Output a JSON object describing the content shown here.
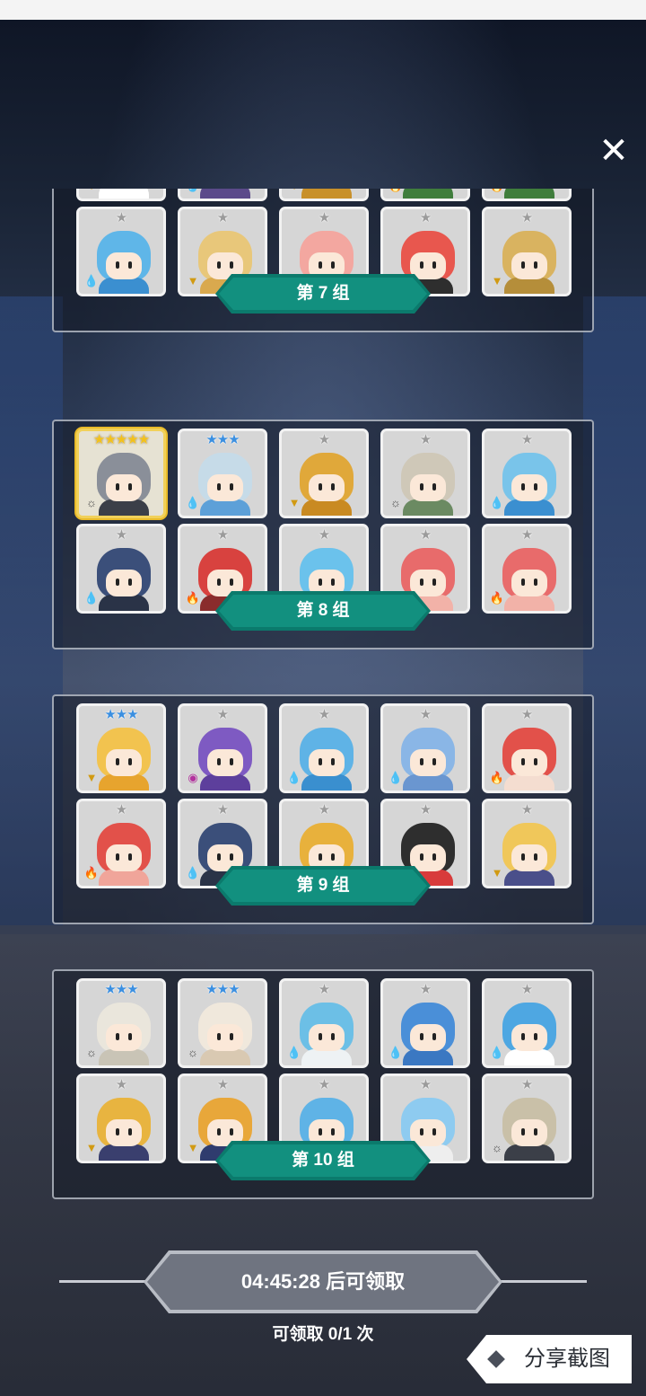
{
  "header": {
    "close_icon": "close-icon"
  },
  "groups": [
    {
      "label": "第 7 组",
      "rows": [
        [
          {
            "stars": "",
            "star_color": "gray",
            "element": "earth",
            "hair": "#f2cf6b",
            "outfit": "#ffffff"
          },
          {
            "stars": "",
            "star_color": "gray",
            "element": "water",
            "hair": "#7cc0e6",
            "outfit": "#5b4a8a"
          },
          {
            "stars": "",
            "star_color": "gray",
            "element": "earth",
            "hair": "#d6a43c",
            "outfit": "#c8902a"
          },
          {
            "stars": "",
            "star_color": "gray",
            "element": "fire",
            "hair": "#e8636a",
            "outfit": "#3f7d3c"
          },
          {
            "stars": "",
            "star_color": "gray",
            "element": "fire",
            "hair": "#e8636a",
            "outfit": "#3f7d3c"
          }
        ],
        [
          {
            "stars": "★",
            "star_color": "gray",
            "element": "water",
            "hair": "#5fb6e8",
            "outfit": "#3b8fd0"
          },
          {
            "stars": "★",
            "star_color": "gray",
            "element": "earth",
            "hair": "#e8c77a",
            "outfit": "#d9a94e"
          },
          {
            "stars": "★",
            "star_color": "gray",
            "element": "fire",
            "hair": "#f3a7a0",
            "outfit": "#e45b55"
          },
          {
            "stars": "★",
            "star_color": "gray",
            "element": "fire",
            "hair": "#e8574e",
            "outfit": "#2e2e2e"
          },
          {
            "stars": "★",
            "star_color": "gray",
            "element": "earth",
            "hair": "#d9b360",
            "outfit": "#b58e3a"
          }
        ]
      ]
    },
    {
      "label": "第 8 组",
      "rows": [
        [
          {
            "stars": "★★★★★",
            "star_color": "gold",
            "element": "light",
            "hair": "#8a8f99",
            "outfit": "#3b3f48",
            "highlight": true
          },
          {
            "stars": "★★★",
            "star_color": "blue",
            "element": "water",
            "hair": "#c6dbe8",
            "outfit": "#5da0d8"
          },
          {
            "stars": "★",
            "star_color": "gray",
            "element": "earth",
            "hair": "#e0a83a",
            "outfit": "#c98a22"
          },
          {
            "stars": "★",
            "star_color": "gray",
            "element": "light",
            "hair": "#cfc8b8",
            "outfit": "#6b8a62"
          },
          {
            "stars": "★",
            "star_color": "gray",
            "element": "water",
            "hair": "#79c4ea",
            "outfit": "#3b8fd0"
          }
        ],
        [
          {
            "stars": "★",
            "star_color": "gray",
            "element": "water",
            "hair": "#3b4f7a",
            "outfit": "#2a3347"
          },
          {
            "stars": "★",
            "star_color": "gray",
            "element": "fire",
            "hair": "#d8423f",
            "outfit": "#8a2c2c"
          },
          {
            "stars": "★",
            "star_color": "gray",
            "element": "water",
            "hair": "#6bc2ec",
            "outfit": "#eaeef2"
          },
          {
            "stars": "★",
            "star_color": "gray",
            "element": "fire",
            "hair": "#e86b6b",
            "outfit": "#f2b2a8"
          },
          {
            "stars": "★",
            "star_color": "gray",
            "element": "fire",
            "hair": "#e86b6b",
            "outfit": "#f2b2a8"
          }
        ]
      ]
    },
    {
      "label": "第 9 组",
      "rows": [
        [
          {
            "stars": "★★★",
            "star_color": "blue",
            "element": "earth",
            "hair": "#f2c34f",
            "outfit": "#e7a42e"
          },
          {
            "stars": "★",
            "star_color": "gray",
            "element": "dark",
            "hair": "#7e5ac2",
            "outfit": "#5d3f9c"
          },
          {
            "stars": "★",
            "star_color": "gray",
            "element": "water",
            "hair": "#5fb3e6",
            "outfit": "#3a8fcf"
          },
          {
            "stars": "★",
            "star_color": "gray",
            "element": "water",
            "hair": "#8ab6e6",
            "outfit": "#6a96d0"
          },
          {
            "stars": "★",
            "star_color": "gray",
            "element": "fire",
            "hair": "#e2514a",
            "outfit": "#f4ddd0"
          }
        ],
        [
          {
            "stars": "★",
            "star_color": "gray",
            "element": "fire",
            "hair": "#e2514a",
            "outfit": "#f0a59a"
          },
          {
            "stars": "★",
            "star_color": "gray",
            "element": "water",
            "hair": "#3b4f7a",
            "outfit": "#2a3347"
          },
          {
            "stars": "★",
            "star_color": "gray",
            "element": "earth",
            "hair": "#e8b13c",
            "outfit": "#2e2e2e"
          },
          {
            "stars": "★",
            "star_color": "gray",
            "element": "fire",
            "hair": "#2e2e2e",
            "outfit": "#d83b3b"
          },
          {
            "stars": "★",
            "star_color": "gray",
            "element": "earth",
            "hair": "#f0c75a",
            "outfit": "#4a4f8a"
          }
        ]
      ]
    },
    {
      "label": "第 10 组",
      "rows": [
        [
          {
            "stars": "★★★",
            "star_color": "blue",
            "element": "light",
            "hair": "#eae6dc",
            "outfit": "#c9c4b6"
          },
          {
            "stars": "★★★",
            "star_color": "blue",
            "element": "light",
            "hair": "#f0e8dc",
            "outfit": "#d9c9b2"
          },
          {
            "stars": "★",
            "star_color": "gray",
            "element": "water",
            "hair": "#6cbfe6",
            "outfit": "#eef2f4"
          },
          {
            "stars": "★",
            "star_color": "gray",
            "element": "water",
            "hair": "#4a8fd8",
            "outfit": "#3b78c2"
          },
          {
            "stars": "★",
            "star_color": "gray",
            "element": "water",
            "hair": "#4ea7e2",
            "outfit": "#ffffff"
          }
        ],
        [
          {
            "stars": "★",
            "star_color": "gray",
            "element": "earth",
            "hair": "#e8b440",
            "outfit": "#3a3f6e"
          },
          {
            "stars": "★",
            "star_color": "gray",
            "element": "earth",
            "hair": "#e8a73a",
            "outfit": "#2f3c6e"
          },
          {
            "stars": "★",
            "star_color": "gray",
            "element": "water",
            "hair": "#5fb3e6",
            "outfit": "#3a8fcf"
          },
          {
            "stars": "★",
            "star_color": "gray",
            "element": "water",
            "hair": "#8ecbf0",
            "outfit": "#eeeeee"
          },
          {
            "stars": "★",
            "star_color": "gray",
            "element": "light",
            "hair": "#c9c0a8",
            "outfit": "#3b3f48"
          }
        ]
      ]
    }
  ],
  "element_icons": {
    "water": "💧",
    "fire": "🔥",
    "earth": "▼",
    "light": "☼",
    "dark": "◉"
  },
  "footer": {
    "timer_label": "04:45:28 后可领取",
    "claim_count": "可领取 0/1 次",
    "share_label": "分享截图"
  }
}
